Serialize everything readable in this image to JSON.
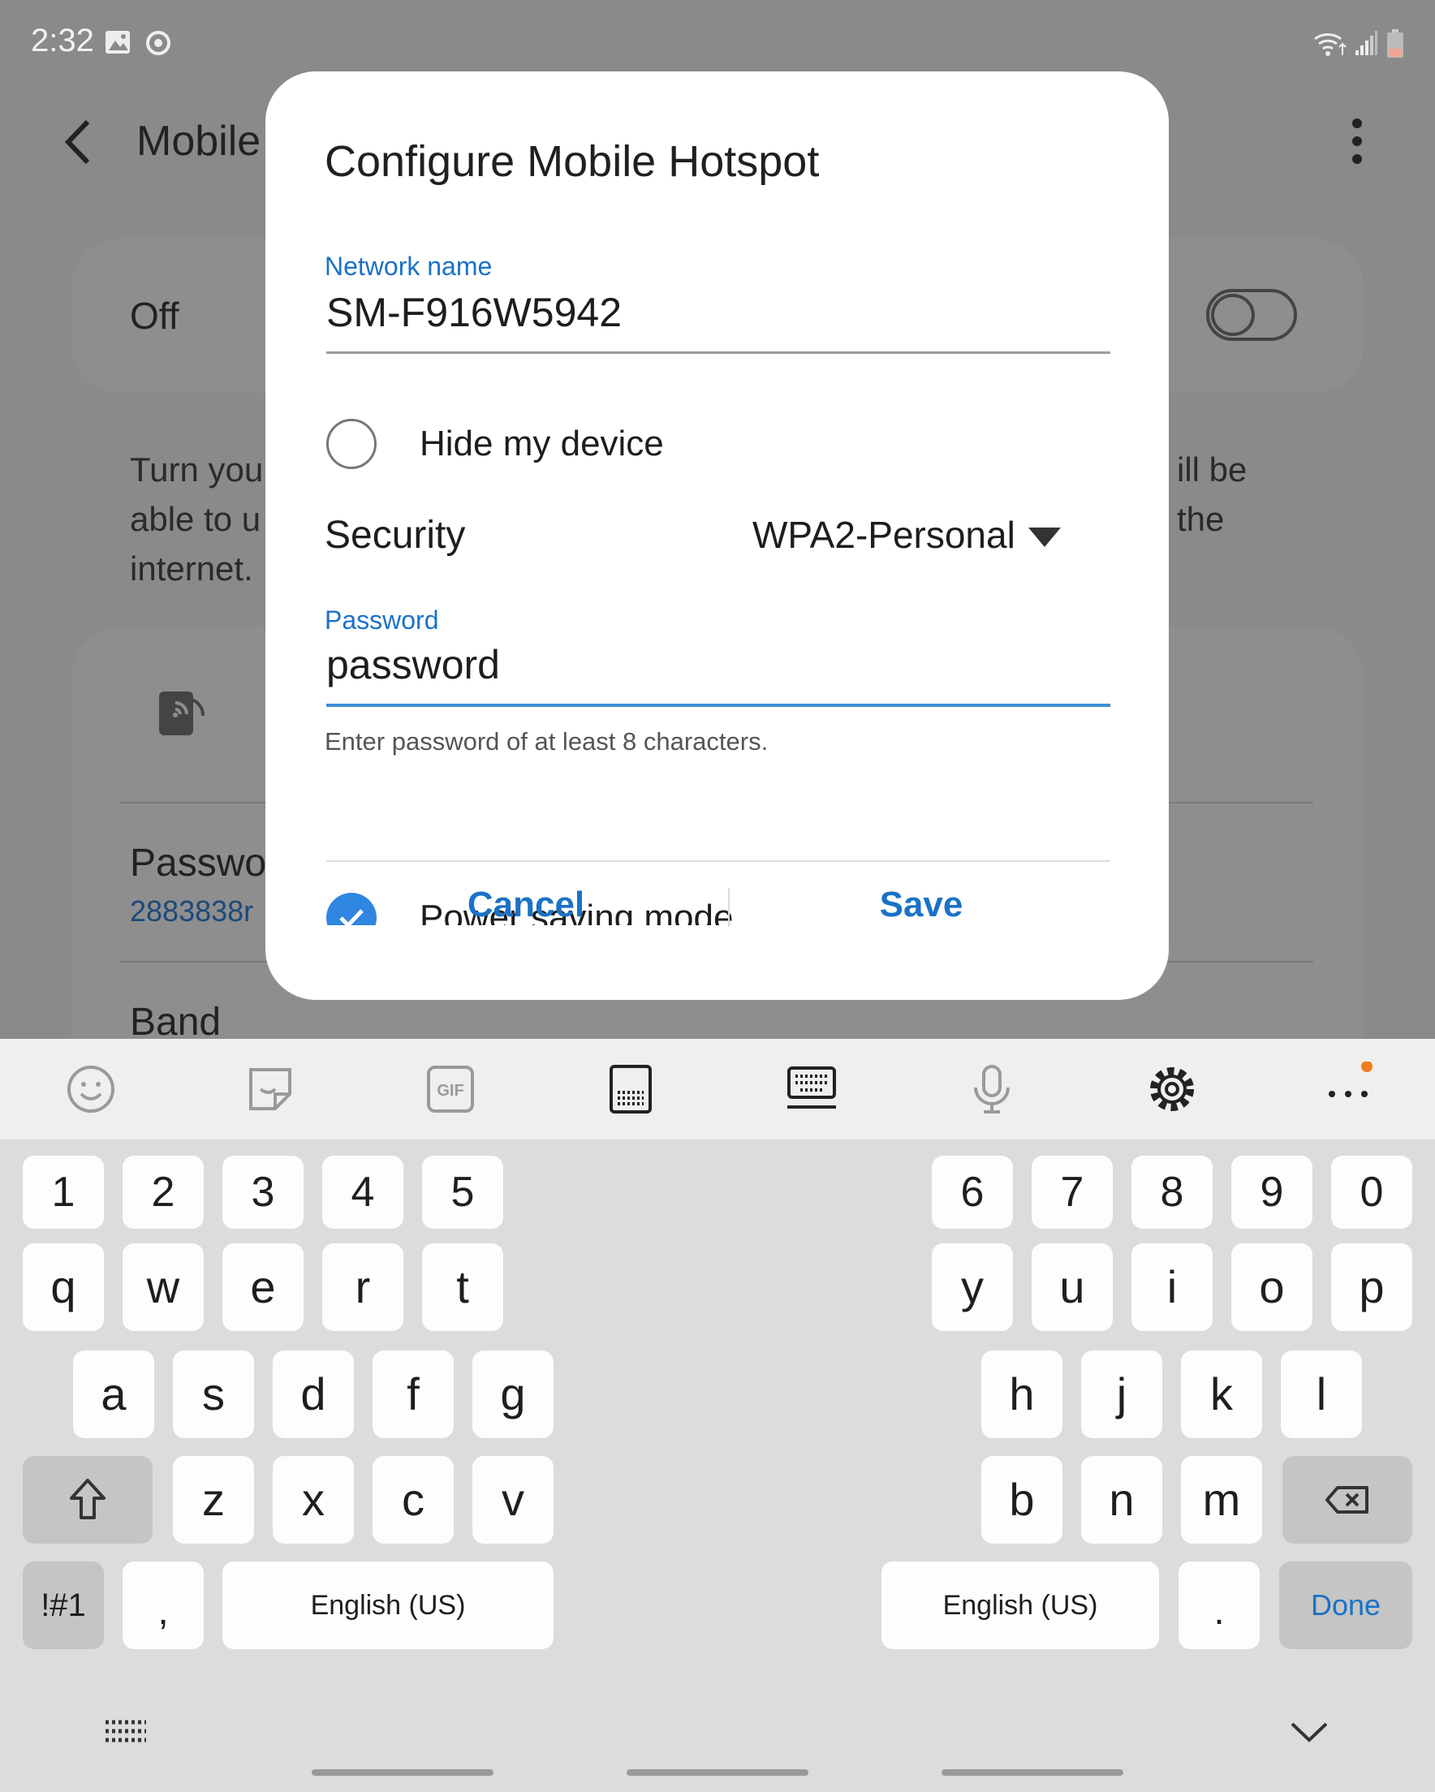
{
  "status_bar": {
    "time": "2:32"
  },
  "background": {
    "app_title": "Mobile",
    "toggle_label": "Off",
    "description_left": "Turn you\nable to u\ninternet.",
    "description_right": "ill be\nthe",
    "password_label": "Passwo",
    "password_value": "2883838r",
    "band_label": "Band"
  },
  "dialog": {
    "title": "Configure Mobile Hotspot",
    "network_name_label": "Network name",
    "network_name_value": "SM-F916W5942",
    "hide_device_label": "Hide my device",
    "hide_device_checked": false,
    "security_label": "Security",
    "security_value": "WPA2-Personal",
    "password_label": "Password",
    "password_value": "password",
    "password_helper": "Enter password of at least 8 characters.",
    "power_saving_label": "Power saving mode",
    "power_saving_checked": true,
    "cancel_label": "Cancel",
    "save_label": "Save"
  },
  "keyboard": {
    "toolbar_icons": [
      "emoji-icon",
      "sticker-icon",
      "gif-icon",
      "keyboard-layout-icon",
      "split-keyboard-icon",
      "microphone-icon",
      "gear-icon",
      "more-icon"
    ],
    "gif_text": "GIF",
    "number_row_left": [
      "1",
      "2",
      "3",
      "4",
      "5"
    ],
    "number_row_right": [
      "6",
      "7",
      "8",
      "9",
      "0"
    ],
    "row1_left": [
      "q",
      "w",
      "e",
      "r",
      "t"
    ],
    "row1_right": [
      "y",
      "u",
      "i",
      "o",
      "p"
    ],
    "row2_left": [
      "a",
      "s",
      "d",
      "f",
      "g"
    ],
    "row2_right": [
      "h",
      "j",
      "k",
      "l"
    ],
    "row3_left": [
      "z",
      "x",
      "c",
      "v"
    ],
    "row3_right": [
      "b",
      "n",
      "m"
    ],
    "symbols_label": "!#1",
    "comma_label": ",",
    "space_left_label": "English (US)",
    "space_right_label": "English (US)",
    "period_label": ".",
    "done_label": "Done",
    "accent_color": "#1a72c6",
    "notification_dot_color": "#f07c1a"
  }
}
